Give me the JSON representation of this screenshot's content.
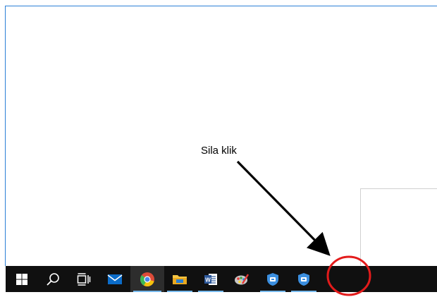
{
  "annotation": {
    "label": "Sila klik"
  },
  "taskbar": {
    "items": [
      {
        "icon": "windows-start-icon",
        "running": false,
        "active": false
      },
      {
        "icon": "search-icon",
        "running": false,
        "active": false
      },
      {
        "icon": "task-view-icon",
        "running": false,
        "active": false
      },
      {
        "icon": "mail-icon",
        "running": false,
        "active": false
      },
      {
        "icon": "chrome-icon",
        "running": true,
        "active": true
      },
      {
        "icon": "file-explorer-icon",
        "running": true,
        "active": false
      },
      {
        "icon": "word-icon",
        "running": true,
        "active": false
      },
      {
        "icon": "paint-icon",
        "running": false,
        "active": false
      },
      {
        "icon": "shield-app-icon",
        "running": true,
        "active": false
      },
      {
        "icon": "shield-app-icon",
        "running": true,
        "active": false
      }
    ]
  },
  "colors": {
    "taskbar_bg": "#101010",
    "running_indicator": "#76b9ed",
    "highlight_circle": "#e31b1b",
    "frame_border": "#2b7fd6"
  }
}
